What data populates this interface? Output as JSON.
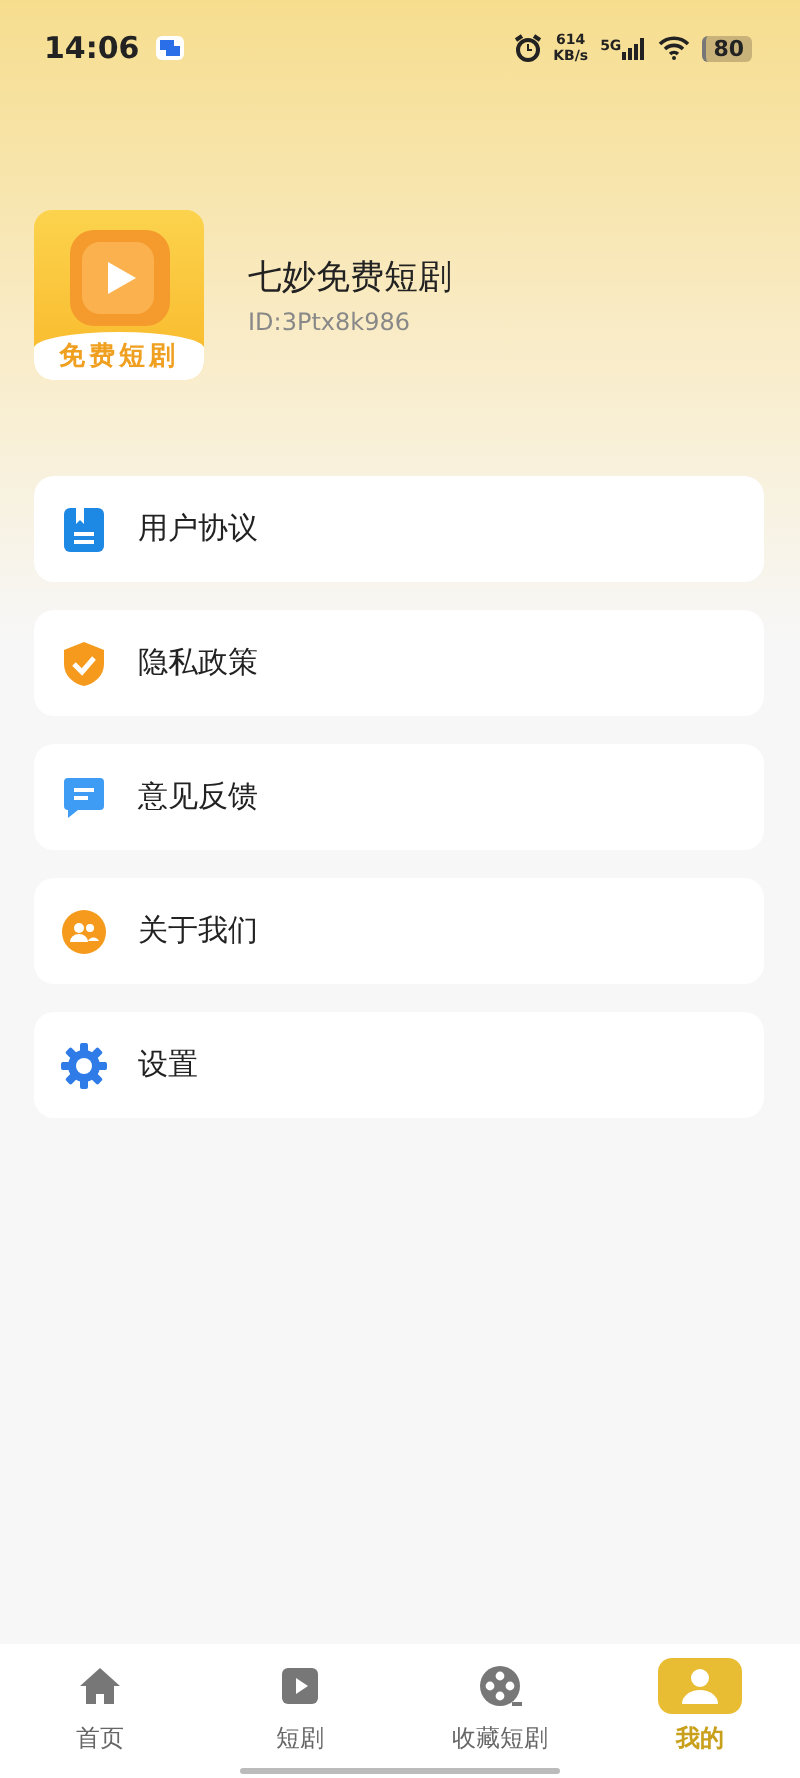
{
  "status_bar": {
    "time": "14:06",
    "speed": "614",
    "speed_unit": "KB/s",
    "network": "5G",
    "battery": "80"
  },
  "profile": {
    "logo_caption": "免费短剧",
    "name": "七妙免费短剧",
    "id": "ID:3Ptx8k986"
  },
  "menu": [
    {
      "kind": "document",
      "label": "用户协议"
    },
    {
      "kind": "shield",
      "label": "隐私政策"
    },
    {
      "kind": "chat",
      "label": "意见反馈"
    },
    {
      "kind": "people",
      "label": "关于我们"
    },
    {
      "kind": "gear",
      "label": "设置"
    }
  ],
  "tabs": [
    {
      "kind": "home",
      "label": "首页",
      "selected": false
    },
    {
      "kind": "play",
      "label": "短剧",
      "selected": false
    },
    {
      "kind": "reel",
      "label": "收藏短剧",
      "selected": false
    },
    {
      "kind": "person",
      "label": "我的",
      "selected": true
    }
  ]
}
